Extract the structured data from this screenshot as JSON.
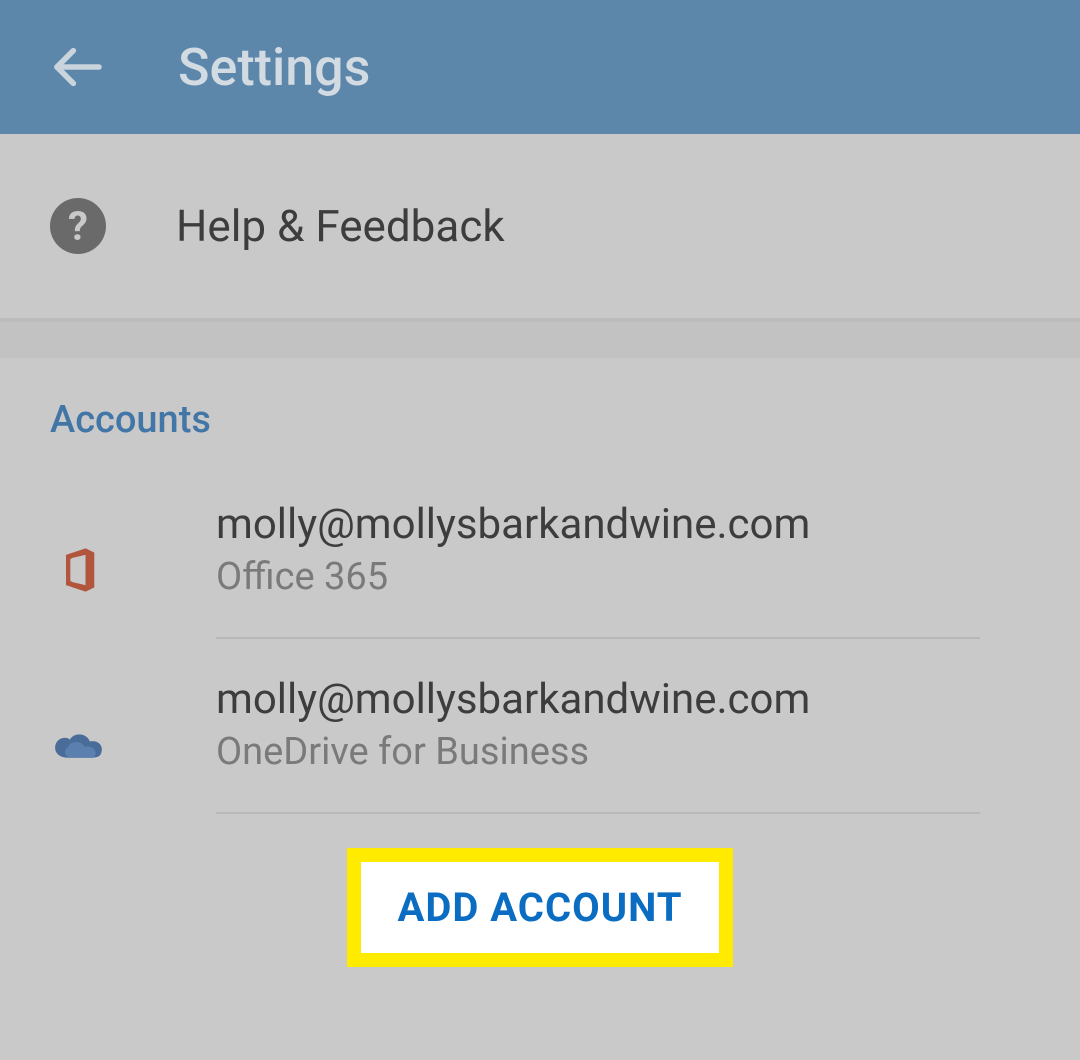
{
  "header": {
    "title": "Settings"
  },
  "help": {
    "label": "Help & Feedback"
  },
  "accounts": {
    "section_title": "Accounts",
    "items": [
      {
        "email": "molly@mollysbarkandwine.com",
        "service": "Office 365",
        "icon": "office-icon"
      },
      {
        "email": "molly@mollysbarkandwine.com",
        "service": "OneDrive for Business",
        "icon": "onedrive-icon"
      }
    ],
    "add_button": "ADD ACCOUNT"
  },
  "colors": {
    "header_bg": "#5C87AB",
    "accent": "#4276A7",
    "highlight": "#FFEB00",
    "link": "#0a6dc2"
  }
}
